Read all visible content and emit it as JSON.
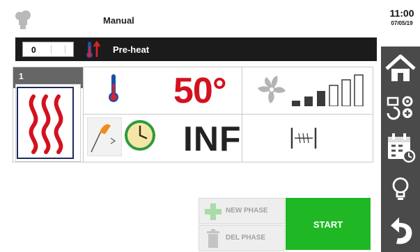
{
  "header": {
    "mode_title": "Manual"
  },
  "preheat": {
    "counter_value": "0",
    "label": "Pre-heat"
  },
  "phase": {
    "number": "1",
    "temperature": "50°",
    "time": "INF",
    "fan_level": "3 of 6"
  },
  "actions": {
    "new_phase": "NEW PHASE",
    "del_phase": "DEL PHASE",
    "start": "START"
  },
  "clock": {
    "time": "11:00",
    "date": "07/05/19"
  },
  "colors": {
    "accent_red": "#d3121f",
    "start_green": "#1fb824",
    "sidebar": "#4a4a4a",
    "bar": "#1b1b1b"
  },
  "icons": [
    "chef-hat-icon",
    "thermometer-icon",
    "heat-waves-icon",
    "fan-icon",
    "fan-speed-bars-icon",
    "cooking-mode-icon",
    "timer-clock-icon",
    "damper-icon",
    "plus-icon",
    "trash-icon",
    "home-icon",
    "settings-cycle-icon",
    "calendar-icon",
    "lightbulb-icon",
    "back-arrow-icon"
  ]
}
